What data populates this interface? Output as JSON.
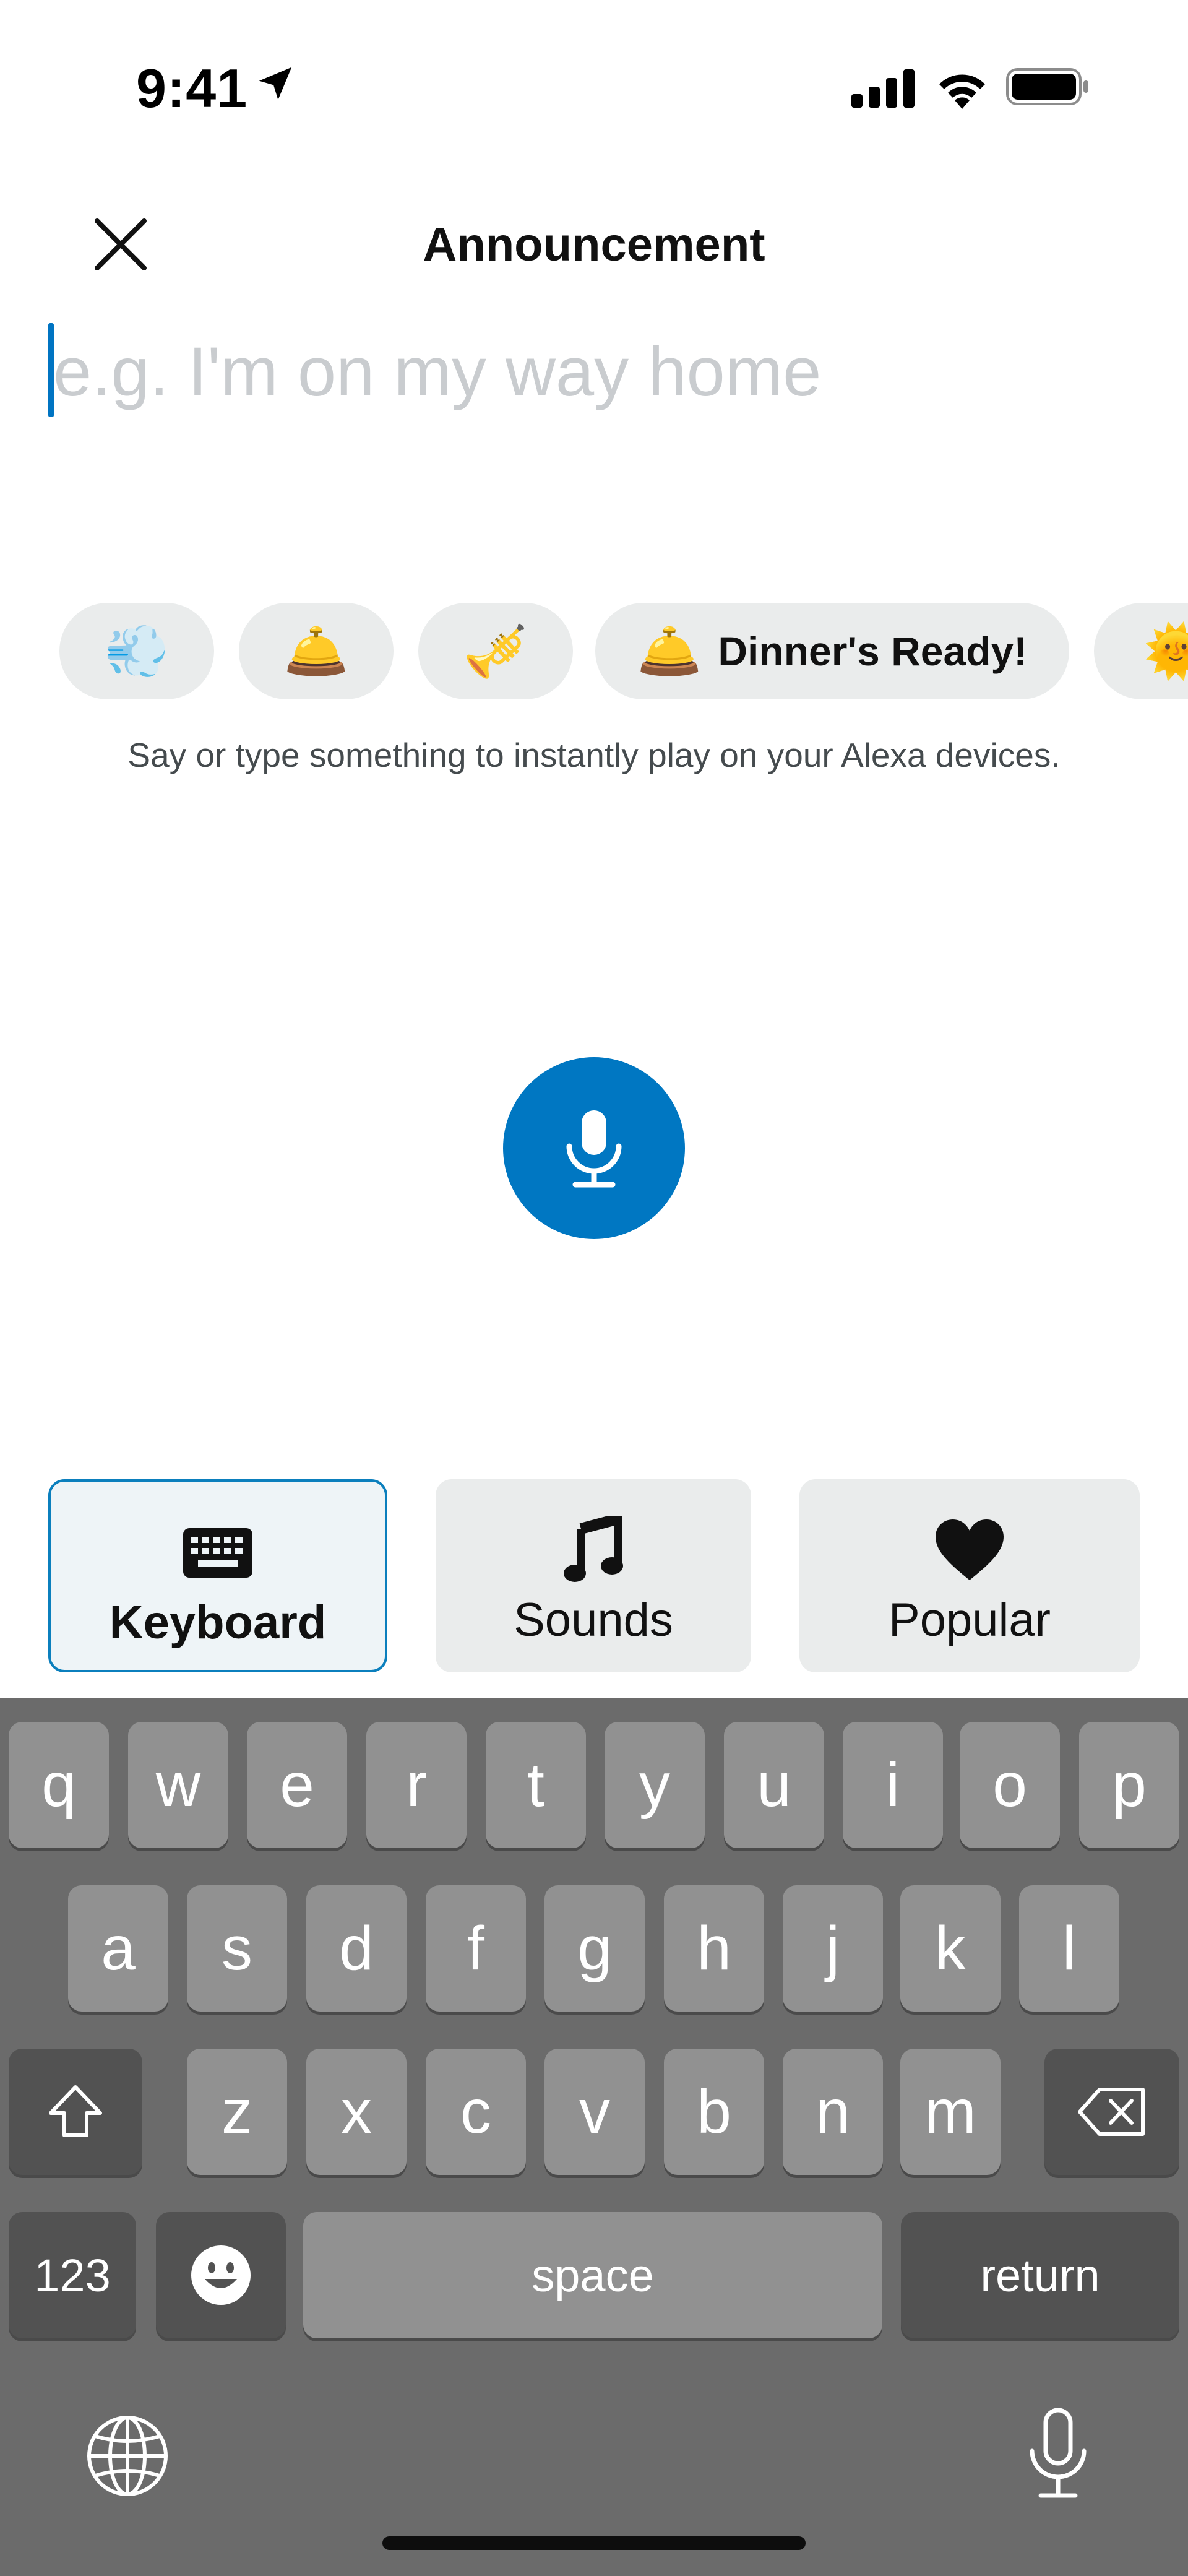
{
  "status_bar": {
    "time": "9:41",
    "icons": [
      "location-arrow-icon",
      "cellular-signal-icon",
      "wifi-icon",
      "battery-icon"
    ]
  },
  "header": {
    "title": "Announcement",
    "close_icon": "close-icon"
  },
  "input": {
    "value": "",
    "placeholder": "e.g. I'm on my way home"
  },
  "chips": [
    {
      "emoji": "💨",
      "label": ""
    },
    {
      "emoji": "🛎️",
      "label": ""
    },
    {
      "emoji": "🎺",
      "label": ""
    },
    {
      "emoji": "🛎️",
      "label": "Dinner's Ready!"
    },
    {
      "emoji": "🌞",
      "label": ""
    }
  ],
  "hint": "Say or type something to instantly play on your Alexa devices.",
  "mic_icon": "microphone-icon",
  "modes": {
    "keyboard": "Keyboard",
    "sounds": "Sounds",
    "popular": "Popular",
    "selected": "Keyboard"
  },
  "colors": {
    "accent": "#0077c2",
    "placeholder": "#c9cccf",
    "chip_bg": "#eaecec",
    "keyboard_bg": "#6b6b6b",
    "key_light": "#919191",
    "key_dark": "#525252"
  },
  "keyboard": {
    "row1": [
      "q",
      "w",
      "e",
      "r",
      "t",
      "y",
      "u",
      "i",
      "o",
      "p"
    ],
    "row2": [
      "a",
      "s",
      "d",
      "f",
      "g",
      "h",
      "j",
      "k",
      "l"
    ],
    "row3": [
      "z",
      "x",
      "c",
      "v",
      "b",
      "n",
      "m"
    ],
    "numbers": "123",
    "space": "space",
    "return": "return",
    "icons": [
      "shift-icon",
      "delete-icon",
      "emoji-icon",
      "globe-icon",
      "dictation-mic-icon"
    ]
  }
}
